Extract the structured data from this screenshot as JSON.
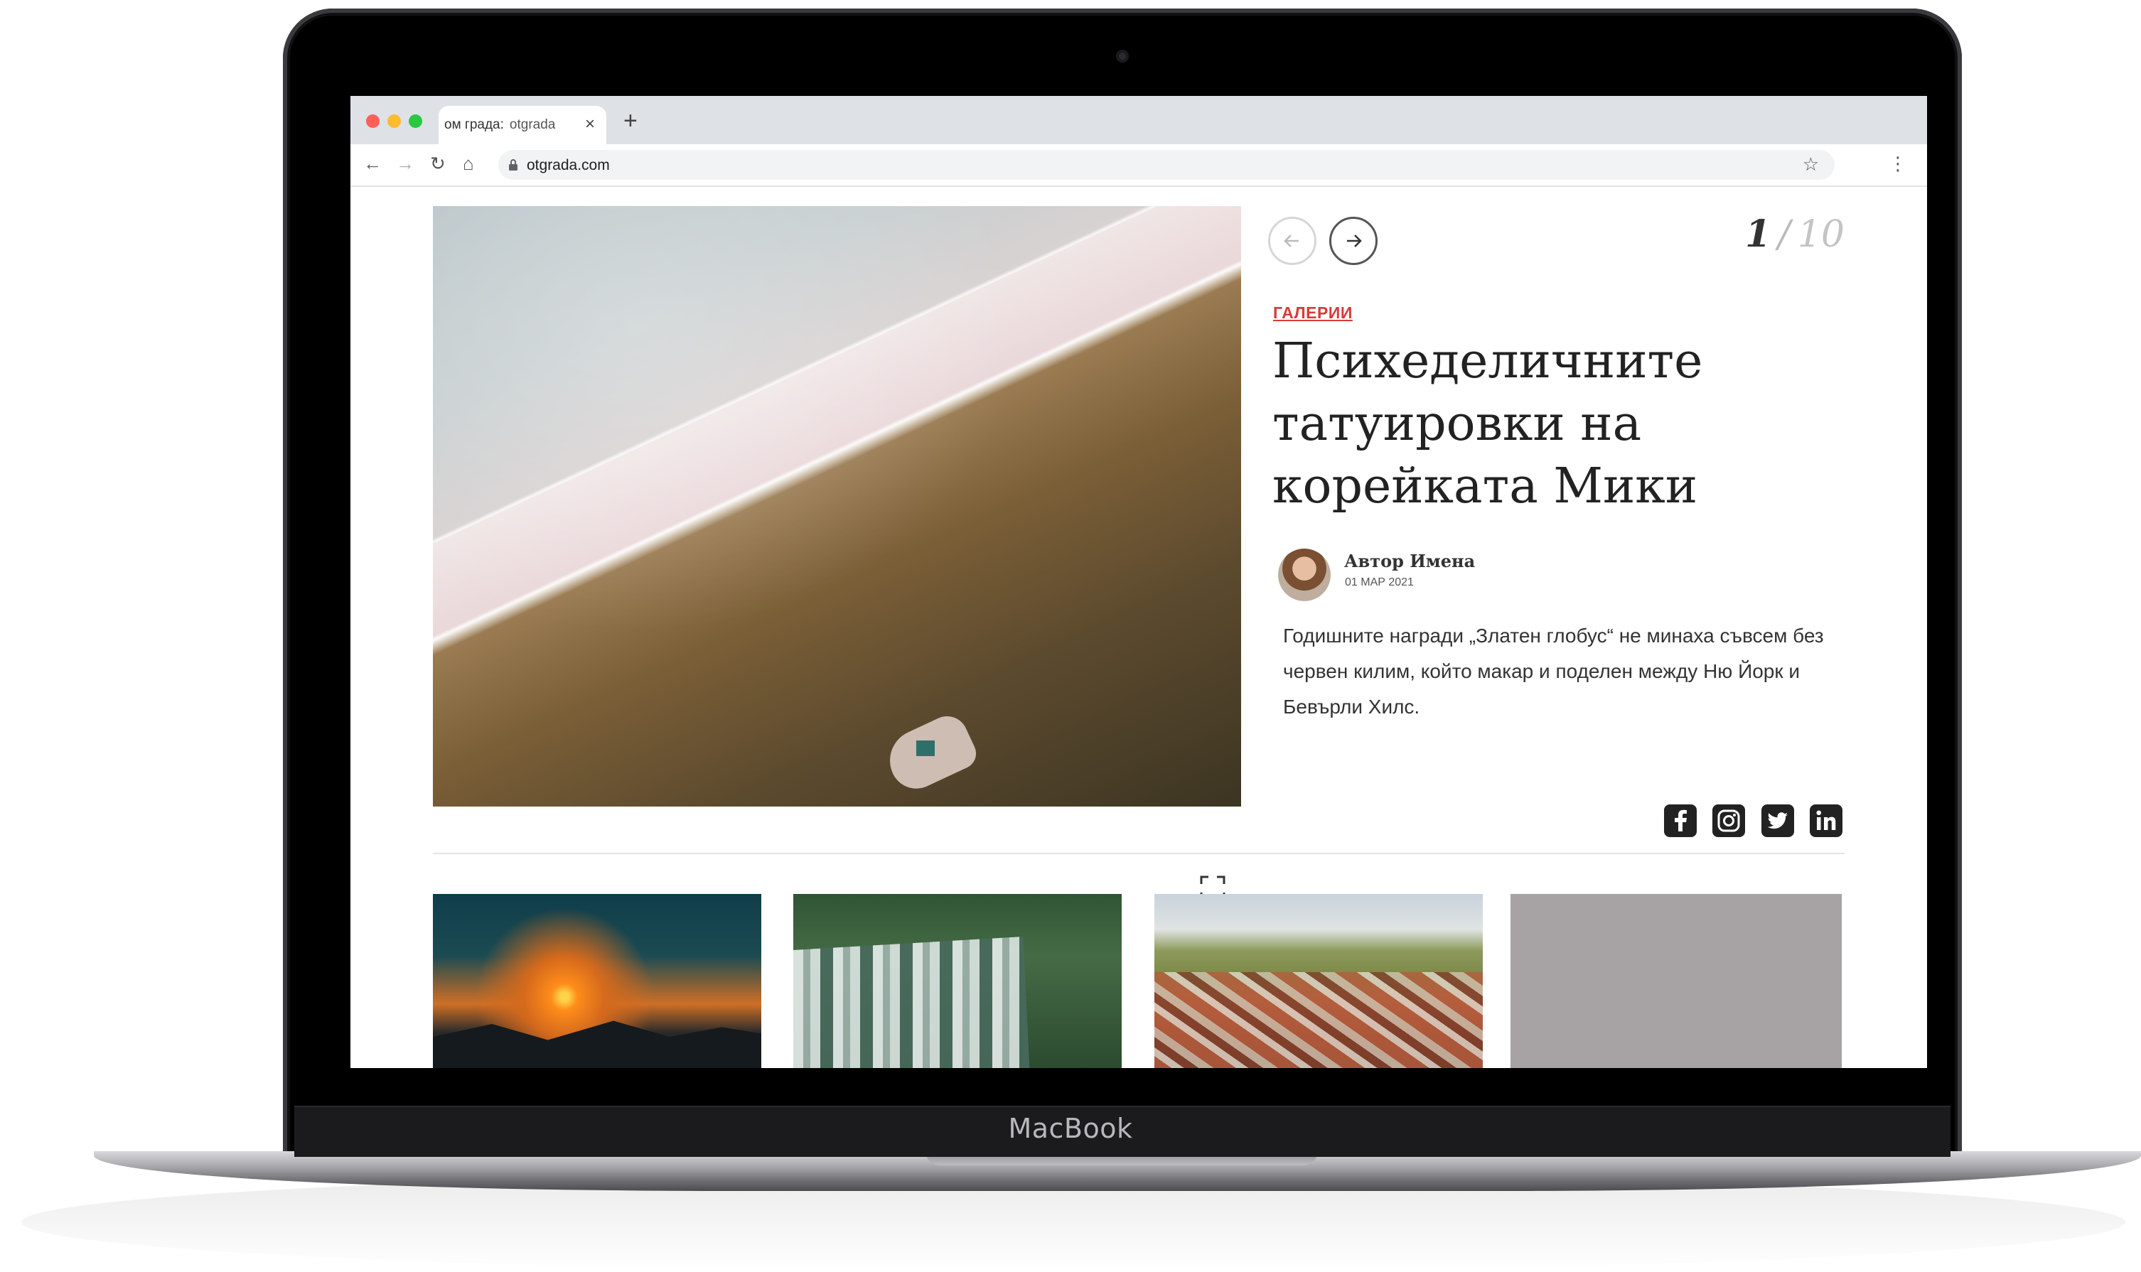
{
  "device": {
    "brand_label": "MacBook"
  },
  "browser": {
    "tab": {
      "title": "ом града:",
      "site": "otgrada",
      "close_glyph": "×"
    },
    "new_tab_glyph": "+",
    "nav": {
      "back_glyph": "←",
      "forward_glyph": "→",
      "reload_glyph": "↻",
      "home_glyph": "⌂"
    },
    "address": {
      "url": "otgrada.com"
    },
    "bookmark_glyph": "☆",
    "menu_glyph": "⋮"
  },
  "gallery": {
    "current": "1",
    "separator": "/",
    "total": "10",
    "category": "ГАЛЕРИИ",
    "headline": "Психеделичните татуировки на корейката Мики",
    "author": {
      "name": "Автор Имена",
      "date": "01 МАР 2021"
    },
    "lead": "Годишните награди „Златен глобус“ не минаха съвсем без червен килим, който макар и поделен между Ню Йорк и Бевърли Хилс.",
    "icons": {
      "prev": "arrow-left-icon",
      "next": "arrow-right-icon",
      "expand": "fullscreen-icon"
    },
    "social": [
      "facebook-icon",
      "instagram-icon",
      "twitter-icon",
      "linkedin-icon"
    ]
  },
  "colors": {
    "accent": "#d63b3b",
    "text": "#222222",
    "placeholder_thumb": "#a7a2a3"
  }
}
